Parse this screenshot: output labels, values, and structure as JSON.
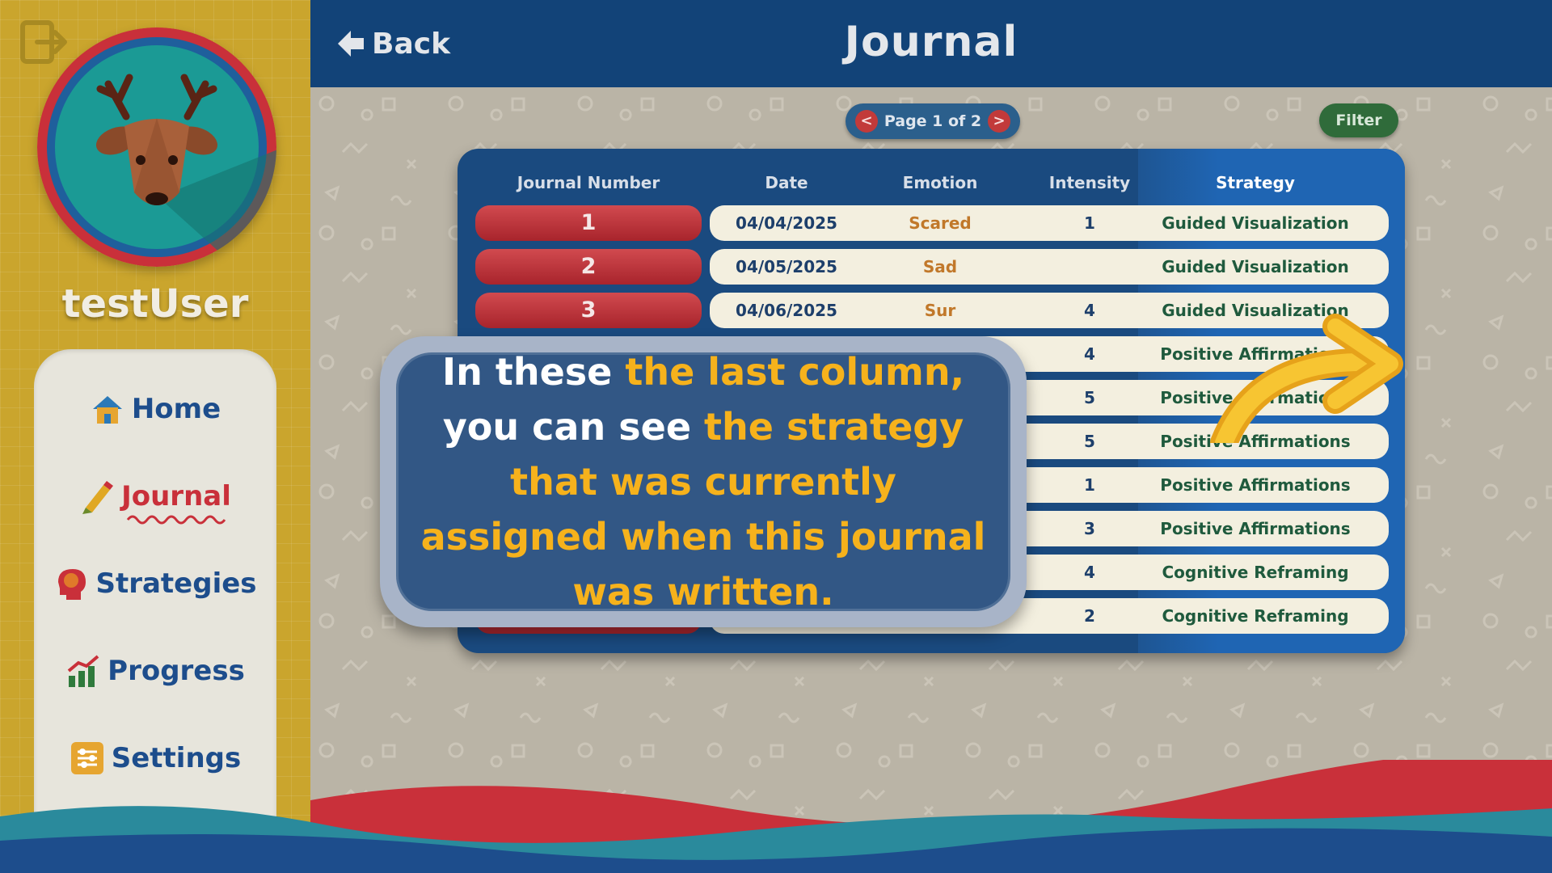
{
  "colors": {
    "header": "#124378",
    "sidebar": "#caa52d",
    "accent_red": "#c9303a",
    "nav_text": "#1d4d8c",
    "highlight": "#f6b21c",
    "strategy_text": "#1f5a3d"
  },
  "sidebar": {
    "username": "testUser",
    "logout_icon": "logout-icon",
    "avatar": "deer-avatar",
    "items": [
      {
        "label": "Home",
        "icon": "home-icon",
        "active": false
      },
      {
        "label": "Journal",
        "icon": "pencil-icon",
        "active": true
      },
      {
        "label": "Strategies",
        "icon": "brain-head-icon",
        "active": false
      },
      {
        "label": "Progress",
        "icon": "chart-icon",
        "active": false
      },
      {
        "label": "Settings",
        "icon": "sliders-icon",
        "active": false
      }
    ]
  },
  "header": {
    "back_label": "Back",
    "title": "Journal"
  },
  "toolbar": {
    "page_label": "Page 1 of 2",
    "prev": "<",
    "next": ">",
    "filter_label": "Filter"
  },
  "table": {
    "columns": [
      "Journal Number",
      "Date",
      "Emotion",
      "Intensity",
      "Strategy"
    ],
    "rows": [
      {
        "number": "1",
        "date": "04/04/2025",
        "emotion": "Scared",
        "intensity": "1",
        "strategy": "Guided Visualization"
      },
      {
        "number": "2",
        "date": "04/05/2025",
        "emotion": "Sad",
        "intensity": "",
        "strategy": "Guided Visualization"
      },
      {
        "number": "3",
        "date": "04/06/2025",
        "emotion": "Sur",
        "intensity": "4",
        "strategy": "Guided Visualization"
      },
      {
        "number": "",
        "date": "",
        "emotion": "",
        "intensity": "4",
        "strategy": "Positive Affirmations"
      },
      {
        "number": "",
        "date": "",
        "emotion": "",
        "intensity": "5",
        "strategy": "Positive Affirmations"
      },
      {
        "number": "",
        "date": "",
        "emotion": "",
        "intensity": "5",
        "strategy": "Positive Affirmations"
      },
      {
        "number": "",
        "date": "",
        "emotion": "",
        "intensity": "1",
        "strategy": "Positive Affirmations"
      },
      {
        "number": "",
        "date": "",
        "emotion": "",
        "intensity": "3",
        "strategy": "Positive Affirmations"
      },
      {
        "number": "",
        "date": "",
        "emotion": "",
        "intensity": "4",
        "strategy": "Cognitive Reframing"
      },
      {
        "number": "",
        "date": "",
        "emotion": "",
        "intensity": "2",
        "strategy": "Cognitive Reframing"
      }
    ]
  },
  "tutorial": {
    "parts": [
      {
        "text": "In these ",
        "highlight": false
      },
      {
        "text": "the last column,",
        "highlight": true
      },
      {
        "text": " you can see ",
        "highlight": false
      },
      {
        "text": "the strategy that was currently assigned when this journal was written.",
        "highlight": true
      }
    ]
  }
}
